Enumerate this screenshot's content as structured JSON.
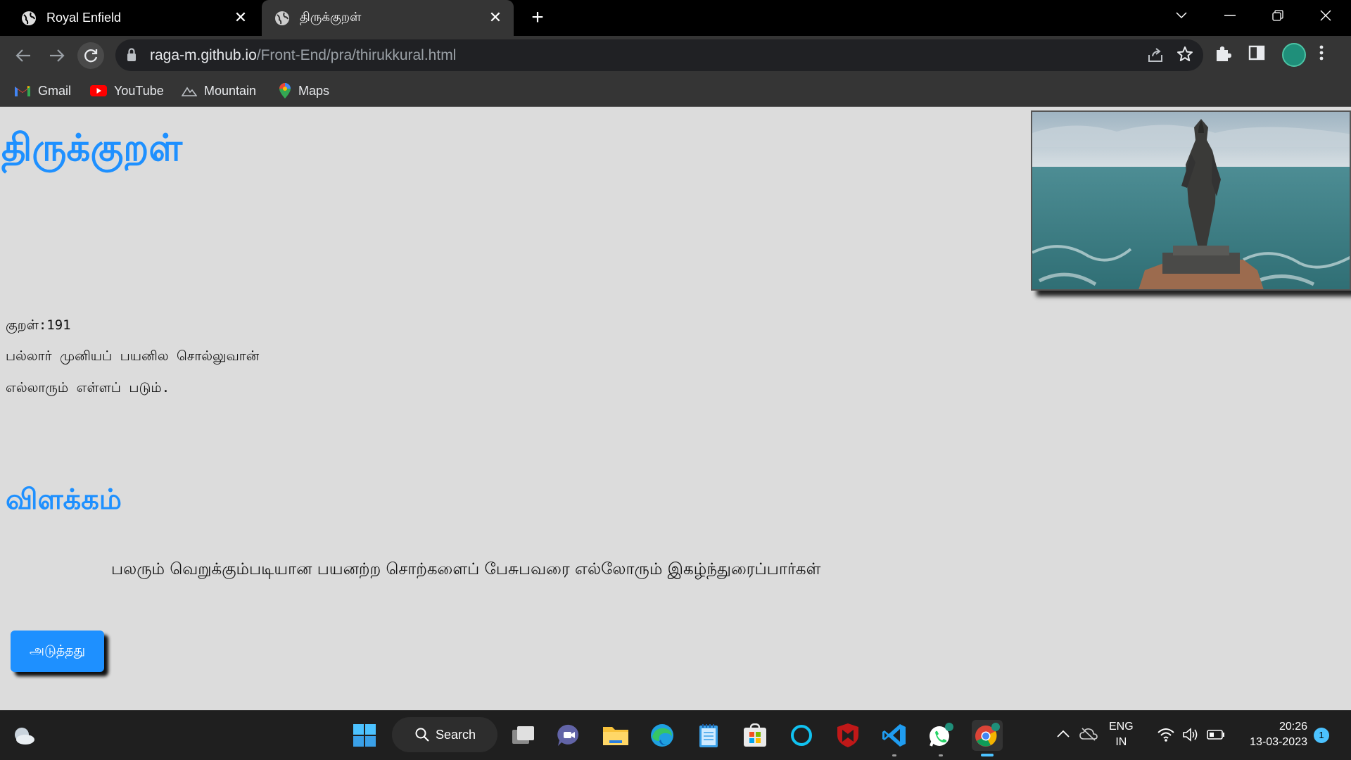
{
  "browser": {
    "tabs": [
      {
        "title": "Royal Enfield",
        "active": false
      },
      {
        "title": "திருக்குறள்",
        "active": true
      }
    ],
    "url_host": "raga-m.github.io",
    "url_path": "/Front-End/pra/thirukkural.html",
    "bookmarks": [
      {
        "label": "Gmail",
        "icon": "gmail-icon"
      },
      {
        "label": "YouTube",
        "icon": "youtube-icon"
      },
      {
        "label": "Mountain",
        "icon": "mountain-icon"
      },
      {
        "label": "Maps",
        "icon": "maps-icon"
      }
    ],
    "colors": {
      "tabbar": "#000000",
      "toolbar": "#353535",
      "omnibox": "#202124"
    }
  },
  "page": {
    "title": "திருக்குறள்",
    "kural_label": "குறள்:191",
    "kural_lines": [
      "பல்லார் முனியப் பயனில சொல்லுவான்",
      "எல்லாரும் எள்ளப் படும்."
    ],
    "explanation_heading": "விளக்கம்",
    "explanation_text": "பலரும் வெறுக்கும்படியான பயனற்ற சொற்களைப் பேசுபவரை எல்லோரும் இகழ்ந்துரைப்பார்கள்",
    "next_button_label": "அடுத்தது",
    "image": "thiruvalluvar-statue-by-the-sea",
    "colors": {
      "accent": "#1e90ff",
      "background": "#dcdcdc"
    }
  },
  "taskbar": {
    "search_label": "Search",
    "language": "ENG",
    "region": "IN",
    "time": "20:26",
    "date": "13-03-2023",
    "notification_count": "1"
  }
}
